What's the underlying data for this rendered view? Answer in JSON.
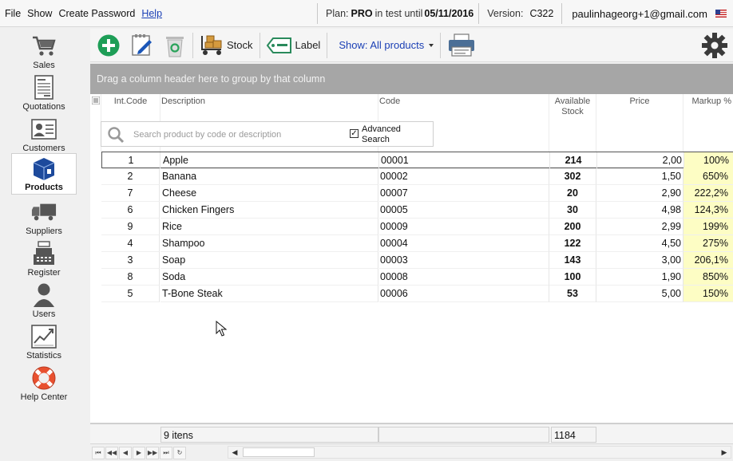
{
  "menu": {
    "file": "File",
    "show": "Show",
    "create_password": "Create Password",
    "help": "Help"
  },
  "plan": {
    "label": "Plan:",
    "name": "PRO",
    "status": "in test until",
    "date": "05/11/2016"
  },
  "version": {
    "label": "Version:",
    "value": "C322"
  },
  "user": {
    "email": "paulinhageorg+1@gmail.com",
    "flag_icon": "us-flag-icon"
  },
  "sidebar": {
    "items": [
      {
        "label": "Sales",
        "icon": "shopping-cart-icon"
      },
      {
        "label": "Quotations",
        "icon": "document-icon"
      },
      {
        "label": "Customers",
        "icon": "contact-card-icon"
      },
      {
        "label": "Products",
        "icon": "box-icon",
        "active": true
      },
      {
        "label": "Suppliers",
        "icon": "truck-icon"
      },
      {
        "label": "Register",
        "icon": "cash-register-icon"
      },
      {
        "label": "Users",
        "icon": "user-icon"
      },
      {
        "label": "Statistics",
        "icon": "chart-icon"
      },
      {
        "label": "Help Center",
        "icon": "lifebuoy-icon"
      }
    ]
  },
  "toolbar": {
    "stock_label": "Stock",
    "label_label": "Label",
    "show_label": "Show: All products"
  },
  "groupbar": {
    "text": "Drag a column header here to group by that column"
  },
  "grid": {
    "columns": {
      "int_code": "Int.Code",
      "description": "Description",
      "code": "Code",
      "stock_line1": "Available",
      "stock_line2": "Stock",
      "price": "Price",
      "markup": "Markup %"
    },
    "search": {
      "placeholder": "Search product by code or description",
      "advanced_line1": "Advanced",
      "advanced_line2": "Search",
      "advanced_checked": true,
      "check_mark": "✓"
    },
    "rows": [
      {
        "int_code": "1",
        "description": "Apple",
        "code": "00001",
        "stock": "214",
        "price": "2,00",
        "markup": "100%"
      },
      {
        "int_code": "2",
        "description": "Banana",
        "code": "00002",
        "stock": "302",
        "price": "1,50",
        "markup": "650%"
      },
      {
        "int_code": "7",
        "description": "Cheese",
        "code": "00007",
        "stock": "20",
        "price": "2,90",
        "markup": "222,2%"
      },
      {
        "int_code": "6",
        "description": "Chicken Fingers",
        "code": "00005",
        "stock": "30",
        "price": "4,98",
        "markup": "124,3%"
      },
      {
        "int_code": "9",
        "description": "Rice",
        "code": "00009",
        "stock": "200",
        "price": "2,99",
        "markup": "199%"
      },
      {
        "int_code": "4",
        "description": "Shampoo",
        "code": "00004",
        "stock": "122",
        "price": "4,50",
        "markup": "275%"
      },
      {
        "int_code": "3",
        "description": "Soap",
        "code": "00003",
        "stock": "143",
        "price": "3,00",
        "markup": "206,1%"
      },
      {
        "int_code": "8",
        "description": "Soda",
        "code": "00008",
        "stock": "100",
        "price": "1,90",
        "markup": "850%"
      },
      {
        "int_code": "5",
        "description": "T-Bone Steak",
        "code": "00006",
        "stock": "53",
        "price": "5,00",
        "markup": "150%"
      }
    ]
  },
  "footer": {
    "count": "9 itens",
    "stock_total": "1184"
  },
  "colors": {
    "markup_bg": "#fdfdc4",
    "groupbar_bg": "#a6a6a6",
    "accent_green": "#1e9e57",
    "accent_blue": "#1a3fb5"
  }
}
